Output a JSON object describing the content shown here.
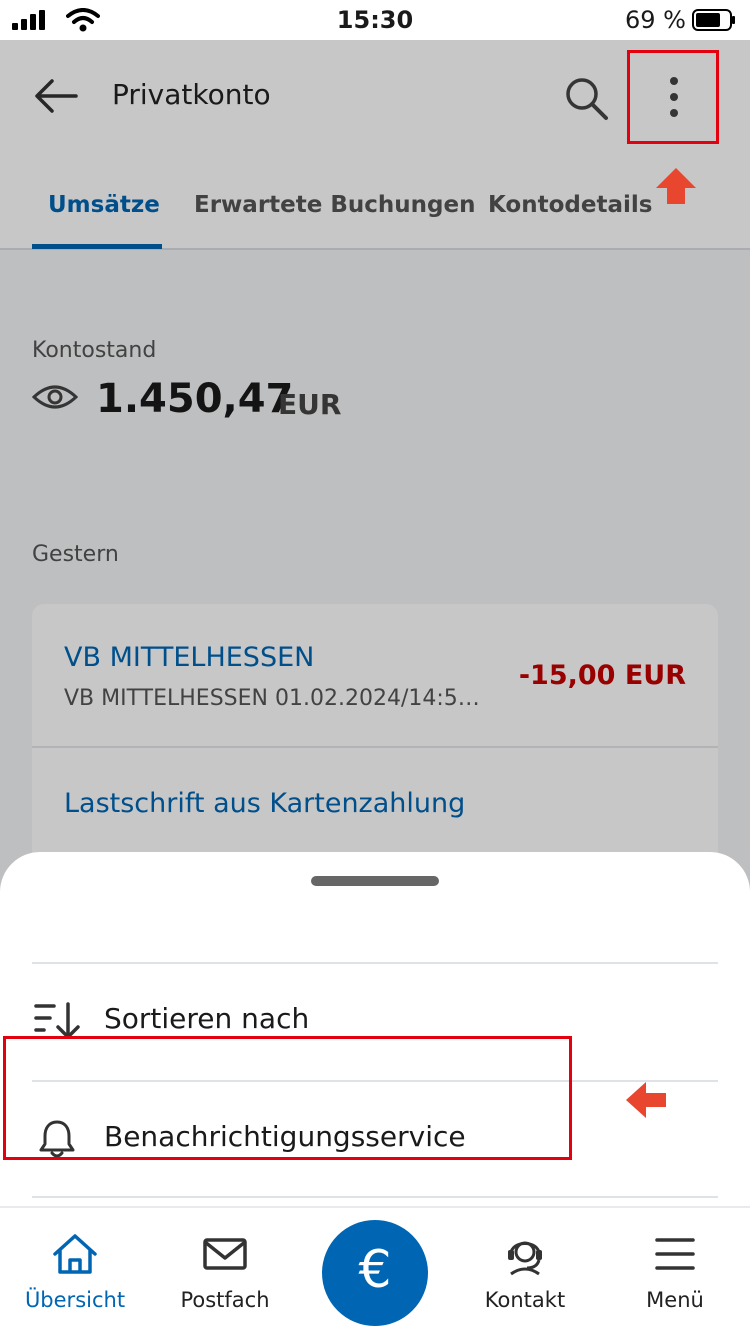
{
  "status_bar": {
    "time": "15:30",
    "battery_percent": "69 %"
  },
  "header": {
    "title": "Privatkonto"
  },
  "tabs": [
    {
      "label": "Umsätze",
      "active": true
    },
    {
      "label": "Erwartete Buchungen",
      "active": false
    },
    {
      "label": "Kontodetails",
      "active": false
    }
  ],
  "balance": {
    "label": "Kontostand",
    "amount": "1.450,47",
    "currency": "EUR"
  },
  "transactions_section": {
    "label": "Gestern"
  },
  "transactions": [
    {
      "title": "VB MITTELHESSEN",
      "subtitle": "VB MITTELHESSEN 01.02.2024/14:5…",
      "amount": "-15,00 EUR"
    },
    {
      "title": "Lastschrift aus Kartenzahlung",
      "subtitle": "",
      "amount": ""
    }
  ],
  "sheet": {
    "items": [
      {
        "label": "Sortieren nach",
        "icon": "sort-icon"
      },
      {
        "label": "Benachrichtigungsservice",
        "icon": "bell-icon"
      }
    ]
  },
  "bottom_nav": [
    {
      "label": "Übersicht",
      "icon": "home-icon",
      "active": true
    },
    {
      "label": "Postfach",
      "icon": "mail-icon",
      "active": false
    },
    {
      "label": "",
      "icon": "euro-icon",
      "symbol": "€"
    },
    {
      "label": "Kontakt",
      "icon": "headset-icon",
      "active": false
    },
    {
      "label": "Menü",
      "icon": "hamburger-icon",
      "active": false
    }
  ],
  "colors": {
    "brand_blue": "#0066b3",
    "negative_red": "#c40000",
    "annotation_red": "#e3000f",
    "annotation_arrow": "#e8462e"
  }
}
